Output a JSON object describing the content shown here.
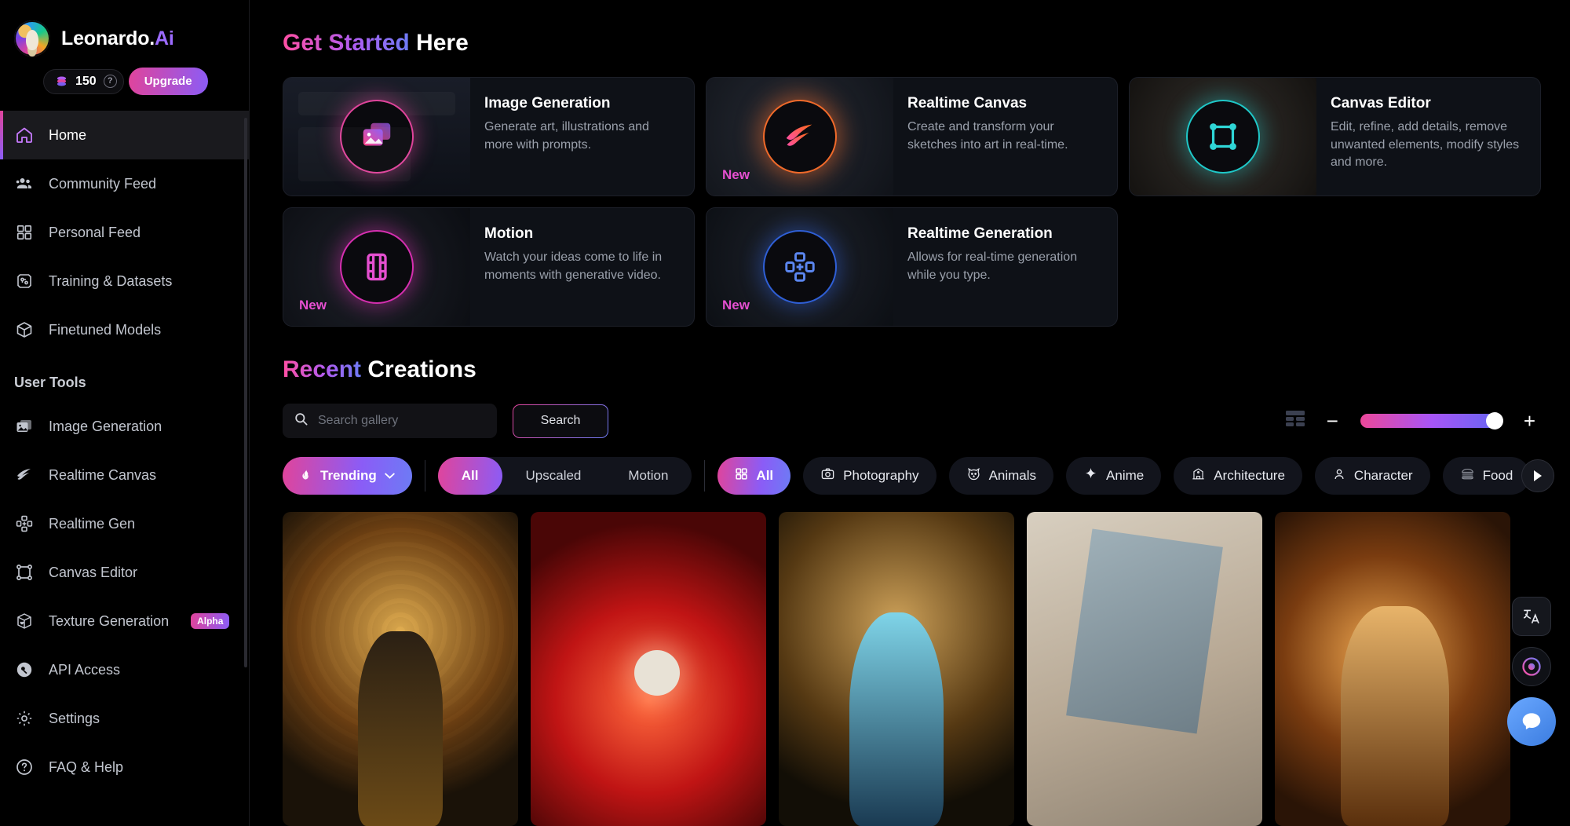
{
  "brand": {
    "name_main": "Leonardo.",
    "name_accent": "Ai",
    "logo_icon": "leonardo-avatar-icon"
  },
  "credits": {
    "amount": "150",
    "coin_icon": "coin-stack-icon",
    "help_icon": "question-mark-icon",
    "upgrade_label": "Upgrade"
  },
  "sidebar": {
    "primary": [
      {
        "label": "Home",
        "icon": "home-icon",
        "active": true
      },
      {
        "label": "Community Feed",
        "icon": "people-icon",
        "active": false
      },
      {
        "label": "Personal Feed",
        "icon": "grid-icon",
        "active": false
      },
      {
        "label": "Training & Datasets",
        "icon": "training-chip-icon",
        "active": false
      },
      {
        "label": "Finetuned Models",
        "icon": "cube-icon",
        "active": false
      }
    ],
    "section_label": "User Tools",
    "tools": [
      {
        "label": "Image Generation",
        "icon": "images-icon",
        "badge": ""
      },
      {
        "label": "Realtime Canvas",
        "icon": "brush-stroke-icon",
        "badge": ""
      },
      {
        "label": "Realtime Gen",
        "icon": "realtime-nodes-icon",
        "badge": ""
      },
      {
        "label": "Canvas Editor",
        "icon": "crop-frame-icon",
        "badge": ""
      },
      {
        "label": "Texture Generation",
        "icon": "texture-cube-icon",
        "badge": "Alpha"
      }
    ],
    "bottom": [
      {
        "label": "API Access",
        "icon": "key-icon"
      },
      {
        "label": "Settings",
        "icon": "gear-icon"
      },
      {
        "label": "FAQ & Help",
        "icon": "question-circle-icon"
      }
    ]
  },
  "get_started": {
    "title_accent": "Get Started",
    "title_rest": " Here",
    "cards": [
      {
        "title": "Image Generation",
        "desc": "Generate art, illustrations and more with prompts.",
        "badge": "",
        "icon": "image-generation-icon"
      },
      {
        "title": "Realtime Canvas",
        "desc": "Create and transform your sketches into art in real-time.",
        "badge": "New",
        "icon": "realtime-canvas-icon"
      },
      {
        "title": "Canvas Editor",
        "desc": "Edit, refine, add details, remove unwanted elements, modify styles and more.",
        "badge": "",
        "icon": "canvas-editor-icon"
      },
      {
        "title": "Motion",
        "desc": "Watch your ideas come to life in moments with generative video.",
        "badge": "New",
        "icon": "motion-film-icon"
      },
      {
        "title": "Realtime Generation",
        "desc": "Allows for real-time generation while you type.",
        "badge": "New",
        "icon": "realtime-generation-icon"
      }
    ]
  },
  "recent": {
    "title_accent": "Recent",
    "title_rest": " Creations",
    "search": {
      "placeholder": "Search gallery",
      "value": "",
      "icon": "search-icon",
      "button_label": "Search"
    },
    "view_controls": {
      "layout_icon": "layout-grid-icon",
      "zoom_out_label": "−",
      "zoom_in_label": "+",
      "zoom_value": "100"
    },
    "sort": {
      "label": "Trending",
      "icon": "flame-icon",
      "chevron": "chevron-down-icon"
    },
    "segments": [
      {
        "label": "All",
        "selected": true
      },
      {
        "label": "Upscaled",
        "selected": false
      },
      {
        "label": "Motion",
        "selected": false
      }
    ],
    "categories": [
      {
        "label": "All",
        "icon": "grid-icon",
        "selected": true
      },
      {
        "label": "Photography",
        "icon": "camera-icon",
        "selected": false
      },
      {
        "label": "Animals",
        "icon": "cat-icon",
        "selected": false
      },
      {
        "label": "Anime",
        "icon": "sparkle-icon",
        "selected": false
      },
      {
        "label": "Architecture",
        "icon": "building-icon",
        "selected": false
      },
      {
        "label": "Character",
        "icon": "person-icon",
        "selected": false
      },
      {
        "label": "Food",
        "icon": "burger-icon",
        "selected": false
      }
    ],
    "next_arrow_icon": "chevron-right-icon",
    "gallery": [
      {
        "alt": "golden armored woman in glowing portal"
      },
      {
        "alt": "red sky with moon and clouds"
      },
      {
        "alt": "blue crystal armored warrior queen"
      },
      {
        "alt": "cracked stone face sculpture portrait"
      },
      {
        "alt": "woman with dragon wings and gold armor"
      }
    ]
  },
  "floating": {
    "translate_icon": "translate-icon",
    "assistant_icon": "assistant-orb-icon",
    "chat_icon": "chat-bubble-icon"
  }
}
